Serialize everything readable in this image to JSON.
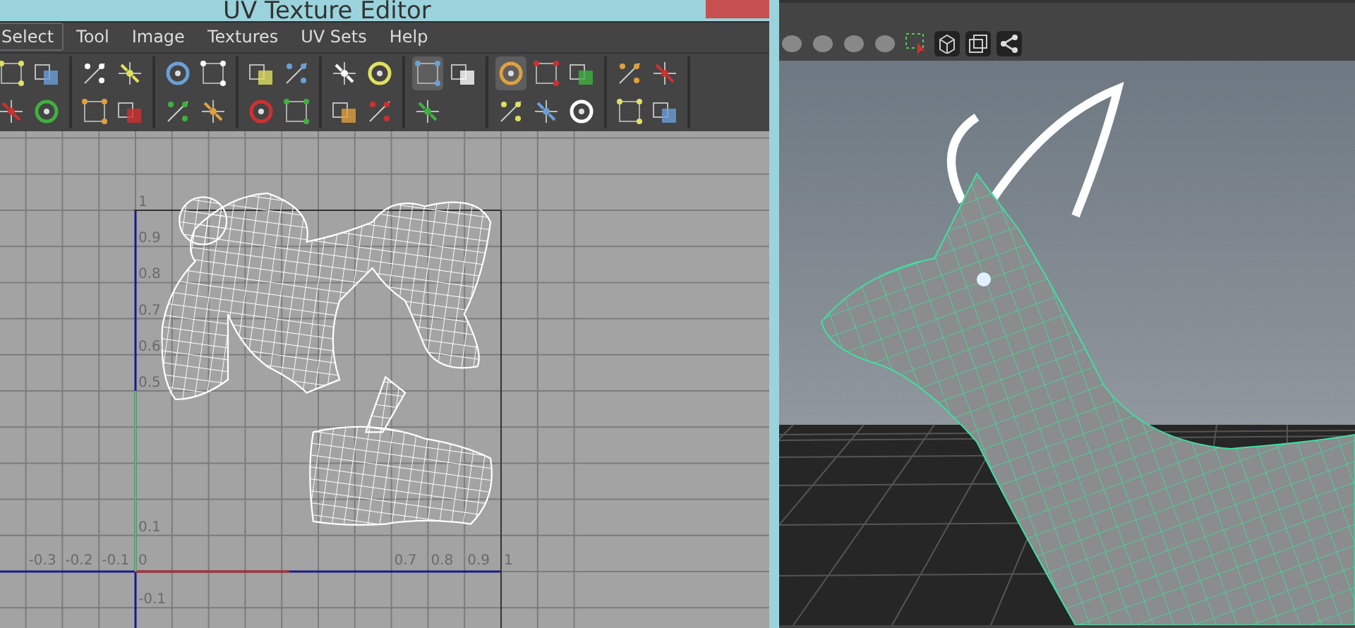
{
  "uv_editor": {
    "title": "UV Texture Editor",
    "menu": [
      {
        "label": "Select",
        "selected": true
      },
      {
        "label": "Tool",
        "selected": false
      },
      {
        "label": "Image",
        "selected": false
      },
      {
        "label": "Textures",
        "selected": false
      },
      {
        "label": "UV Sets",
        "selected": false
      },
      {
        "label": "Help",
        "selected": false
      }
    ],
    "toolbar_groups": [
      {
        "buttons": [
          {
            "pressed": false
          },
          {
            "pressed": false
          },
          {
            "pressed": false
          },
          {
            "pressed": false
          }
        ]
      },
      {
        "buttons": [
          {
            "pressed": false
          },
          {
            "pressed": false
          },
          {
            "pressed": false
          },
          {
            "pressed": false
          }
        ]
      },
      {
        "buttons": [
          {
            "pressed": false
          },
          {
            "pressed": false
          },
          {
            "pressed": false
          },
          {
            "pressed": false
          }
        ]
      },
      {
        "buttons": [
          {
            "pressed": false
          },
          {
            "pressed": false
          },
          {
            "pressed": false
          },
          {
            "pressed": false
          }
        ]
      },
      {
        "buttons": [
          {
            "pressed": false
          },
          {
            "pressed": false
          },
          {
            "pressed": false
          },
          {
            "pressed": false
          }
        ]
      },
      {
        "buttons": [
          {
            "pressed": true
          },
          {
            "pressed": false
          },
          {
            "pressed": false
          }
        ]
      },
      {
        "buttons": [
          {
            "pressed": true
          },
          {
            "pressed": false
          },
          {
            "pressed": false
          },
          {
            "pressed": false
          },
          {
            "pressed": false
          },
          {
            "pressed": false
          }
        ]
      },
      {
        "buttons": [
          {
            "pressed": false
          },
          {
            "pressed": false
          },
          {
            "pressed": false
          },
          {
            "pressed": false
          }
        ]
      }
    ],
    "x_axis_labels": [
      {
        "value": "-0.3"
      },
      {
        "value": "-0.2"
      },
      {
        "value": "-0.1"
      },
      {
        "value": "0"
      },
      {
        "value": "0.7"
      },
      {
        "value": "0.8"
      },
      {
        "value": "0.9"
      },
      {
        "value": "1"
      }
    ],
    "y_axis_labels": [
      {
        "value": "1"
      },
      {
        "value": "0.9"
      },
      {
        "value": "0.8"
      },
      {
        "value": "0.7"
      },
      {
        "value": "0.6"
      },
      {
        "value": "0.5"
      },
      {
        "value": "0.1"
      },
      {
        "value": "-0.1"
      }
    ]
  }
}
